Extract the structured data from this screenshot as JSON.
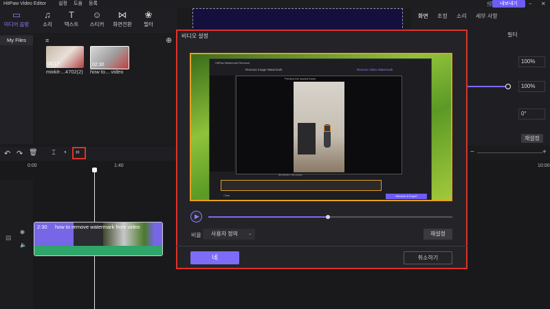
{
  "titlebar": {
    "app_title": "HitPaw Video Editor",
    "menu": [
      "설정",
      "도움",
      "등록"
    ],
    "export_label": "내보내기"
  },
  "toolbar": {
    "items": [
      {
        "label": "미디어 읍방",
        "icon": "media-icon"
      },
      {
        "label": "소리",
        "icon": "music-icon"
      },
      {
        "label": "텍스트",
        "icon": "text-icon"
      },
      {
        "label": "스티커",
        "icon": "sticker-icon"
      },
      {
        "label": "화면전환",
        "icon": "transition-icon"
      },
      {
        "label": "필터",
        "icon": "filter-icon"
      }
    ]
  },
  "sidebar": {
    "my_files": "My Files"
  },
  "media": {
    "items": [
      {
        "name": "mixkit-...4702(2)",
        "duration": "00:17"
      },
      {
        "name": "how to... video",
        "duration": "02:30"
      }
    ]
  },
  "right_panel": {
    "tabs": [
      "화면",
      "조정",
      "소리",
      "세부 사항"
    ],
    "sub_tab": "필터",
    "values": [
      "100%",
      "100%",
      "0°"
    ],
    "reset_label": "재설정",
    "zoom_minus": "−",
    "zoom_plus": "+"
  },
  "timeline": {
    "ticks": [
      "0:00",
      "1:40",
      "10:00"
    ],
    "clip_duration": "2:30",
    "clip_title": "how to remove watermark from video"
  },
  "dialog": {
    "title": "비디오 설정",
    "ratio_label": "비율",
    "ratio_value": "사용자 정의",
    "reset_label": "재설정",
    "ok_label": "네",
    "cancel_label": "취소하기",
    "progress": 0.49,
    "inner_app": {
      "title": "HitPaw Watermark Remover",
      "tab_image": "Remove Image Watermark",
      "tab_video": "Remove Video Watermark",
      "preview_title": "Preview the loaded frame",
      "time_readout": "00:00:00 / 00:15:00",
      "export_label": "Remove & Export",
      "left_button": "Clear"
    }
  }
}
